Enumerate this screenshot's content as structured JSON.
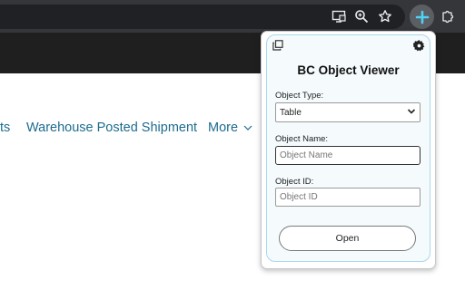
{
  "browser": {
    "icons": [
      "cast-screen-icon",
      "zoom-icon",
      "bookmark-star-icon",
      "extension-active-icon",
      "extensions-puzzle-icon"
    ]
  },
  "page": {
    "nav_partial": "ts",
    "nav_item": "Warehouse Posted Shipment",
    "nav_more": "More"
  },
  "popup": {
    "title": "BC Object Viewer",
    "object_type": {
      "label": "Object Type:",
      "selected": "Table"
    },
    "object_name": {
      "label": "Object Name:",
      "placeholder": "Object Name"
    },
    "object_id": {
      "label": "Object ID:",
      "placeholder": "Object ID"
    },
    "open_button": "Open"
  },
  "colors": {
    "toolbar": "#35363a",
    "link": "#1d6b8f",
    "card_border": "#a9d6ec"
  }
}
